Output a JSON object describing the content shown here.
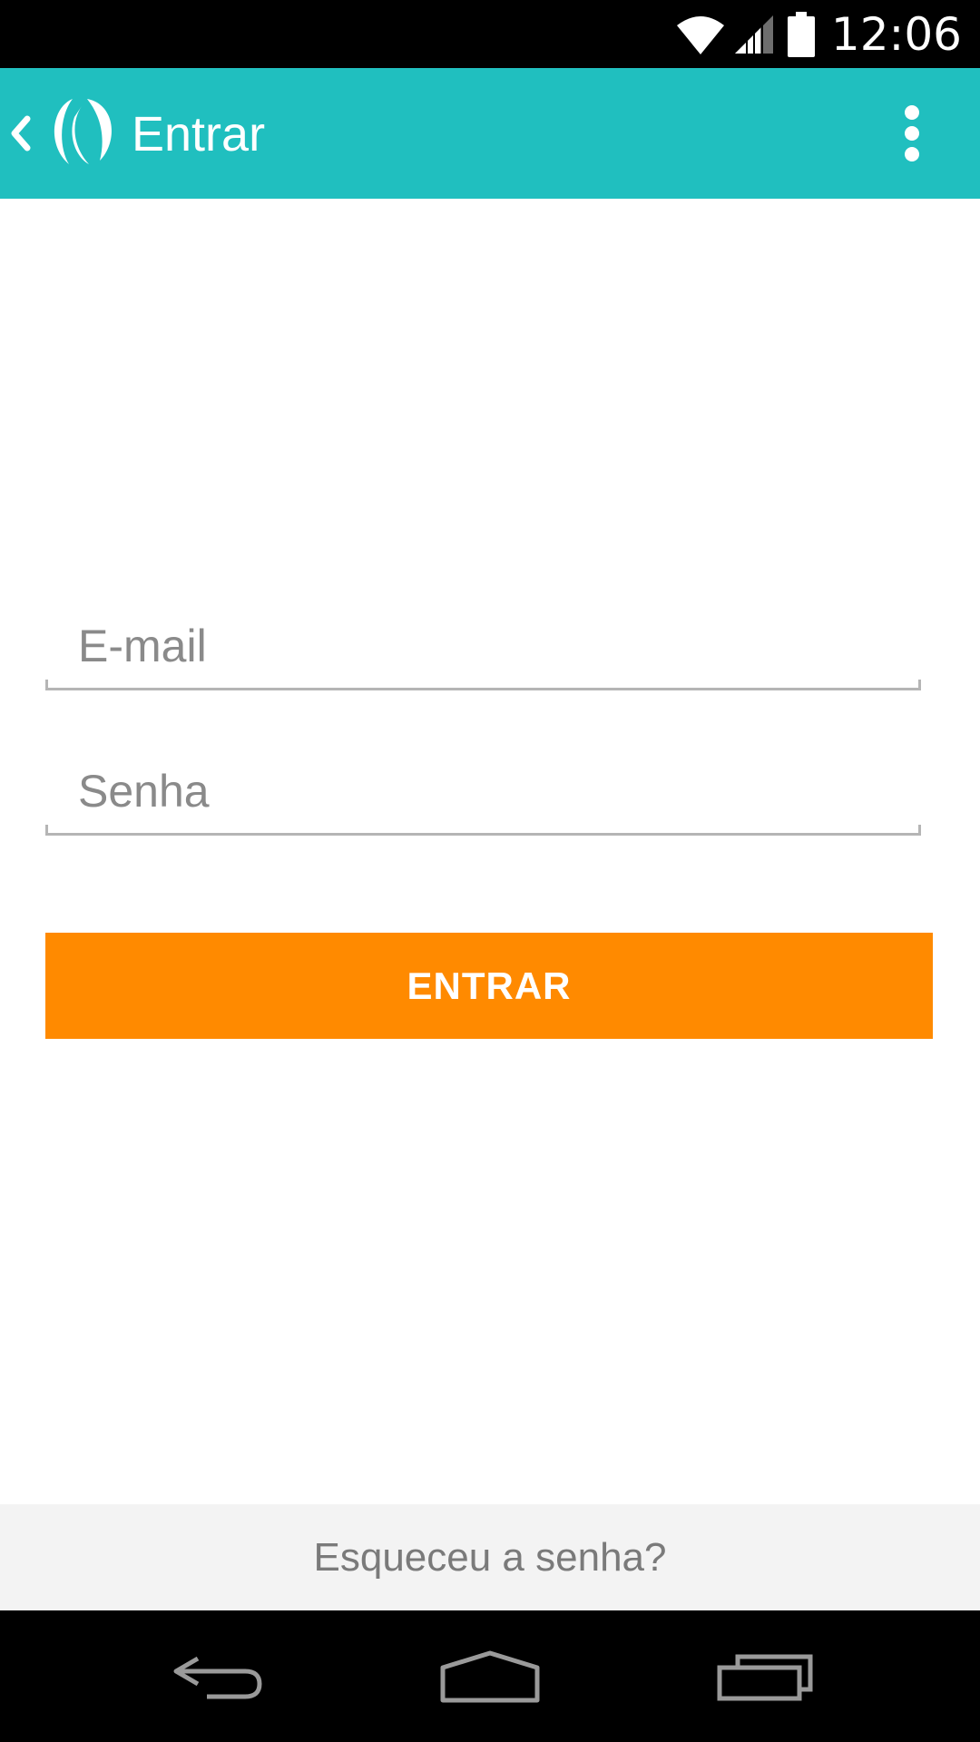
{
  "status_bar": {
    "time": "12:06",
    "icons": [
      "wifi-icon",
      "signal-icon",
      "battery-icon"
    ]
  },
  "action_bar": {
    "title": "Entrar",
    "icons": [
      "chevron-left-icon",
      "app-logo-icon",
      "overflow-menu-icon"
    ]
  },
  "form": {
    "email_placeholder": "E-mail",
    "email_value": "",
    "password_placeholder": "Senha",
    "password_value": "",
    "submit_label": "ENTRAR"
  },
  "forgot_password": {
    "label": "Esqueceu a senha?"
  },
  "nav_bar": {
    "icons": [
      "back-icon",
      "home-icon",
      "recents-icon"
    ]
  },
  "colors": {
    "action_bar": "#20bfbf",
    "primary_button": "#ff8a00",
    "status_bar": "#000000",
    "nav_bar": "#000000",
    "forgot_bar": "#f3f3f3"
  }
}
